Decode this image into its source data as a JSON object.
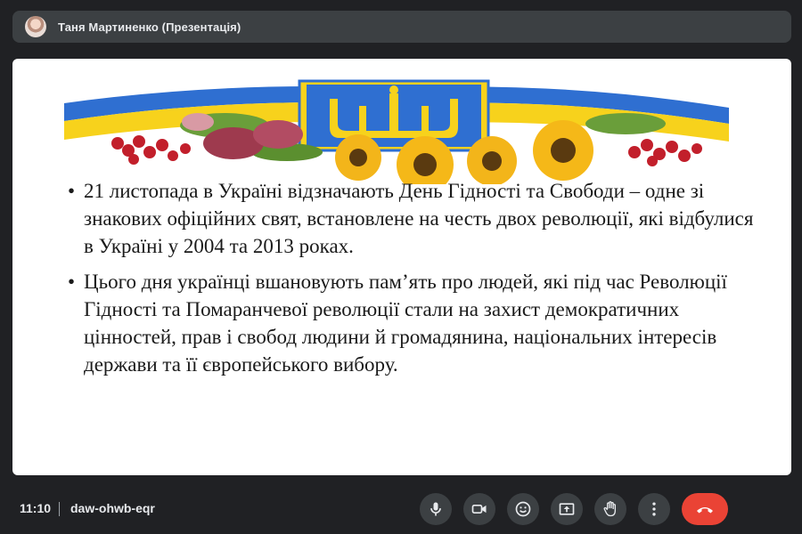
{
  "header": {
    "presenter_label": "Таня Мартиненко (Презентація)"
  },
  "slide": {
    "bullets": [
      "21 листопада в Україні відзначають День Гідності та Свободи – одне зі знакових офіційних свят, встановлене на честь двох революції, які відбулися в Україні у 2004 та 2013 роках.",
      " Цього дня українці вшановують пам’ять про людей, які під час Революції Гідності та Помаранчевої революції стали на захист демократичних цінностей, прав і свобод людини й громадянина, національних інтересів держави та її європейського вибору."
    ]
  },
  "footer": {
    "time": "11:10",
    "meeting_code": "daw-ohwb-eqr"
  },
  "controls": [
    {
      "name": "microphone-button",
      "icon": "microphone-icon"
    },
    {
      "name": "camera-button",
      "icon": "camera-icon"
    },
    {
      "name": "reactions-button",
      "icon": "emoji-icon"
    },
    {
      "name": "present-now-button",
      "icon": "present-screen-icon"
    },
    {
      "name": "raise-hand-button",
      "icon": "hand-icon"
    },
    {
      "name": "more-options-button",
      "icon": "more-vertical-icon"
    },
    {
      "name": "leave-call-button",
      "icon": "phone-hangup-icon"
    }
  ],
  "colors": {
    "background": "#202124",
    "bar": "#3c4043",
    "hangup": "#ea4335",
    "flag_blue": "#2f6fd1",
    "flag_yellow": "#f7d21c"
  }
}
